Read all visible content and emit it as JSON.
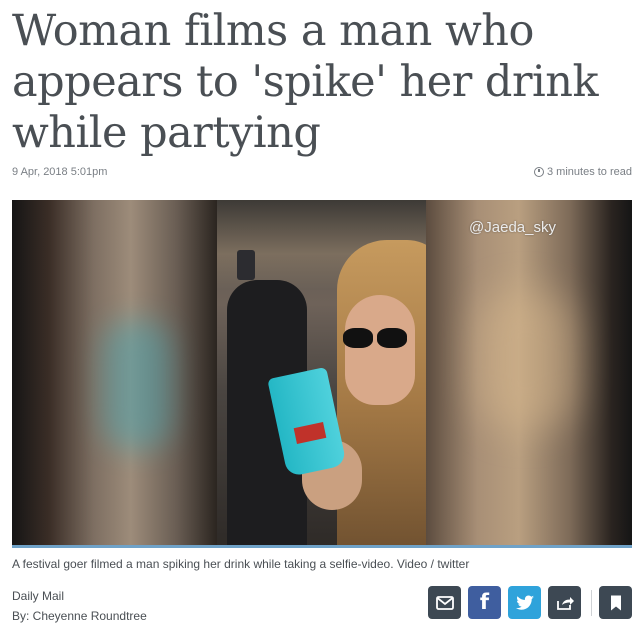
{
  "article": {
    "headline": "Woman films a man who appears to 'spike' her drink while partying",
    "date": "9 Apr, 2018 5:01pm",
    "read_time": "3 minutes to read"
  },
  "video": {
    "watermark": "@Jaeda_sky",
    "progress": 1.0,
    "caption": "A festival goer filmed a man spiking her drink while taking a selfie-video. Video / twitter"
  },
  "credits": {
    "source": "Daily Mail",
    "byline": "By: Cheyenne Roundtree"
  },
  "share": {
    "buttons": [
      {
        "icon": "mail-icon",
        "color": "#3d4853"
      },
      {
        "icon": "facebook-icon",
        "color": "#3f5e9f"
      },
      {
        "icon": "twitter-icon",
        "color": "#2fa3db"
      },
      {
        "icon": "share-icon",
        "color": "#3d4853"
      },
      {
        "icon": "bookmark-icon",
        "color": "#3d4853"
      }
    ]
  }
}
